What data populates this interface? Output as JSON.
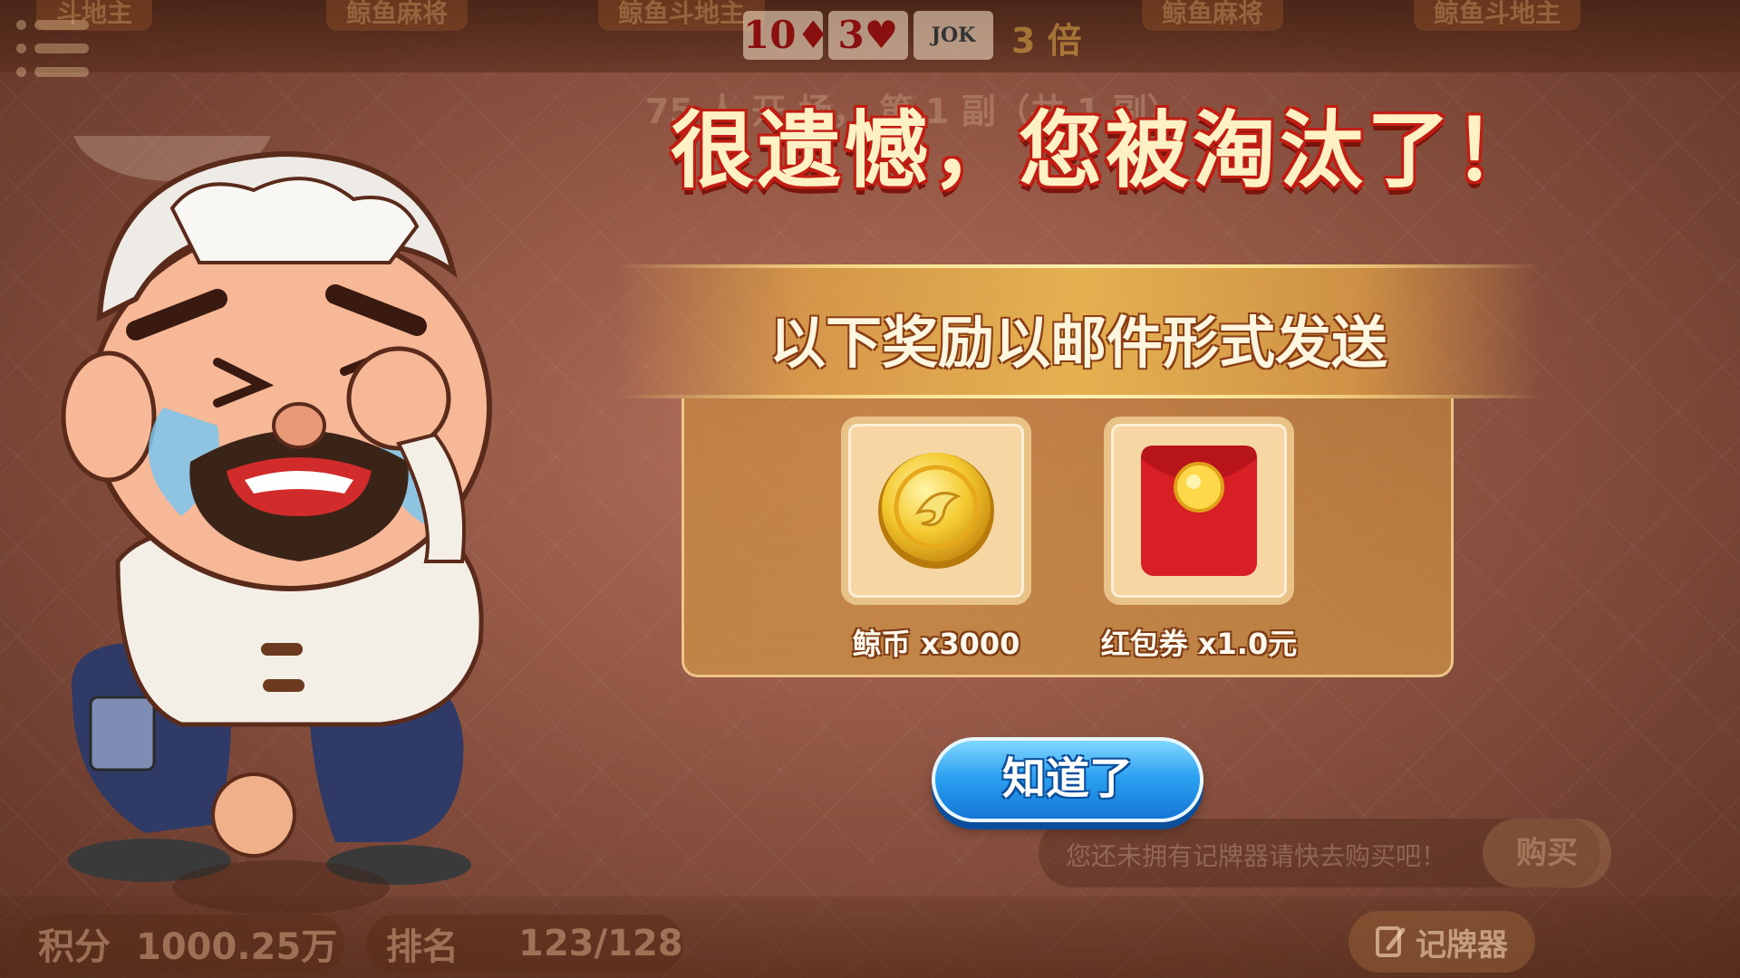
{
  "top_bar": {
    "tabs": [
      "斗地主",
      "鲸鱼麻将",
      "鲸鱼斗地主",
      "鲸鱼麻将",
      "鲸鱼斗地主"
    ],
    "cards": [
      "10♦",
      "3♥",
      "JOK"
    ],
    "multiplier": "3 倍"
  },
  "round_info": "75 人 开 场， 第 1 副（共 1 副）",
  "dialog": {
    "title": "很遗憾，您被淘汰了！",
    "banner": "以下奖励以邮件形式发送",
    "rewards": [
      {
        "name": "whale-coin",
        "label": "鲸币 x3000",
        "icon": "gold-coin-icon"
      },
      {
        "name": "red-packet",
        "label": "红包券 x1.0元",
        "icon": "red-envelope-icon"
      }
    ],
    "ok_label": "知道了"
  },
  "status_bar": {
    "score_label": "积分",
    "score_value": "1000.25万",
    "rank_label": "排名",
    "rank_value": "123/128",
    "notice": "您还未拥有记牌器请快去购买吧！",
    "buy_label": "购买",
    "tracker_label": "记牌器"
  },
  "colors": {
    "title_fill": "#fff1c4",
    "title_outline": "#c21d12",
    "button_blue": "#2a9ff0",
    "panel_gold": "#d2913c"
  }
}
